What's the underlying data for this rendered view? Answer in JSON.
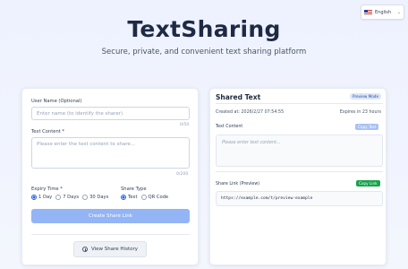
{
  "language": {
    "flag": "us-flag-icon",
    "label": "English"
  },
  "header": {
    "title": "TextSharing",
    "subtitle": "Secure, private, and convenient text sharing platform"
  },
  "form": {
    "username_label": "User Name (Optional)",
    "username_placeholder": "Enter name (to identify the sharer)",
    "username_counter": "0/50",
    "content_label": "Text Content *",
    "content_placeholder": "Please enter the text content to share...",
    "content_counter": "0/200",
    "expiry_label": "Expiry Time *",
    "expiry_options": [
      "1 Day",
      "7 Days",
      "30 Days"
    ],
    "expiry_selected": "1 Day",
    "share_type_label": "Share Type",
    "share_type_options": [
      "Text",
      "QR Code"
    ],
    "share_type_selected": "Text",
    "create_button": "Create Share Link",
    "history_button": "View Share History"
  },
  "preview": {
    "title": "Shared Text",
    "badge": "Preview Mode",
    "created": "Created at: 2026/2/27 07:54:55",
    "expires": "Expires in 23 hours",
    "content_label": "Text Content",
    "copy_text_button": "Copy Text",
    "content_placeholder": "Please enter text content...",
    "link_label": "Share Link (Preview)",
    "copy_link_button": "Copy Link",
    "link_value": "https://example.com/t/preview-example"
  },
  "colors": {
    "primary": "#2563eb",
    "create_button_disabled": "#93b4f5",
    "copy_text_button": "#a9c1f4",
    "copy_link_button": "#16a34a"
  }
}
